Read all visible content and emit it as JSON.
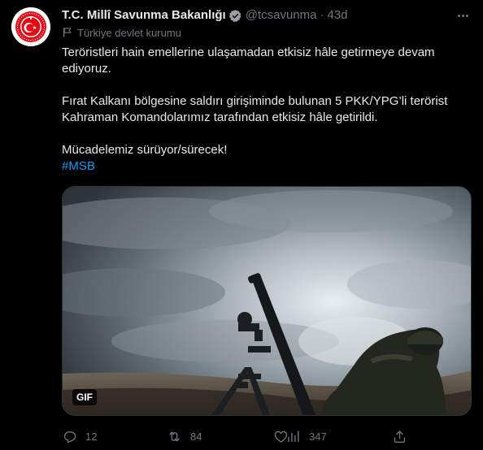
{
  "account": {
    "display_name": "T.C. Millî Savunma Bakanlığı",
    "handle": "@tcsavunma",
    "separator": "·",
    "time": "43d",
    "label": "Türkiye devlet kurumu",
    "avatar_icon": "ministry-seal-icon",
    "verified_icon": "verified-badge-icon"
  },
  "tweet": {
    "paragraph_1": "Teröristleri hain emellerine ulaşamadan etkisiz hâle getirmeye devam ediyoruz.",
    "paragraph_2": "Fırat Kalkanı bölgesine saldırı girişiminde bulunan 5 PKK/YPG’li terörist Kahraman Komandolarımız tarafından etkisiz hâle getirildi.",
    "paragraph_3": "Mücadelemiz sürüyor/sürecek!",
    "hashtag": "#MSB"
  },
  "media": {
    "badge": "GIF",
    "type": "gif"
  },
  "actions": {
    "reply_count": "12",
    "retweet_count": "84",
    "like_count": "",
    "views_count": "347"
  },
  "colors": {
    "background": "#000000",
    "text": "#e7e9ea",
    "secondary": "#71767b",
    "link": "#1d9bf0",
    "seal_red": "#e30a17"
  }
}
